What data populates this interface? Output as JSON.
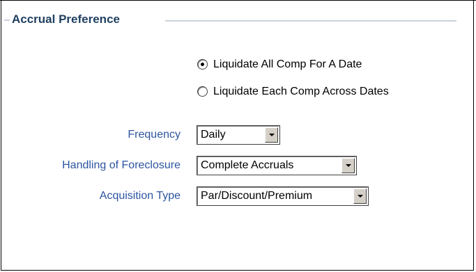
{
  "section": {
    "title": "Accrual Preference"
  },
  "liquidation": {
    "options": [
      {
        "label": "Liquidate All Comp For A Date",
        "selected": true
      },
      {
        "label": "Liquidate Each Comp Across Dates",
        "selected": false
      }
    ]
  },
  "fields": {
    "frequency": {
      "label": "Frequency",
      "value": "Daily"
    },
    "foreclosure": {
      "label": "Handling of Foreclosure",
      "value": "Complete Accruals"
    },
    "acquisition": {
      "label": "Acquisition Type",
      "value": "Par/Discount/Premium"
    }
  },
  "colors": {
    "label": "#2c55a0",
    "title": "#1f3f5f",
    "rule": "#c9d3dc"
  }
}
